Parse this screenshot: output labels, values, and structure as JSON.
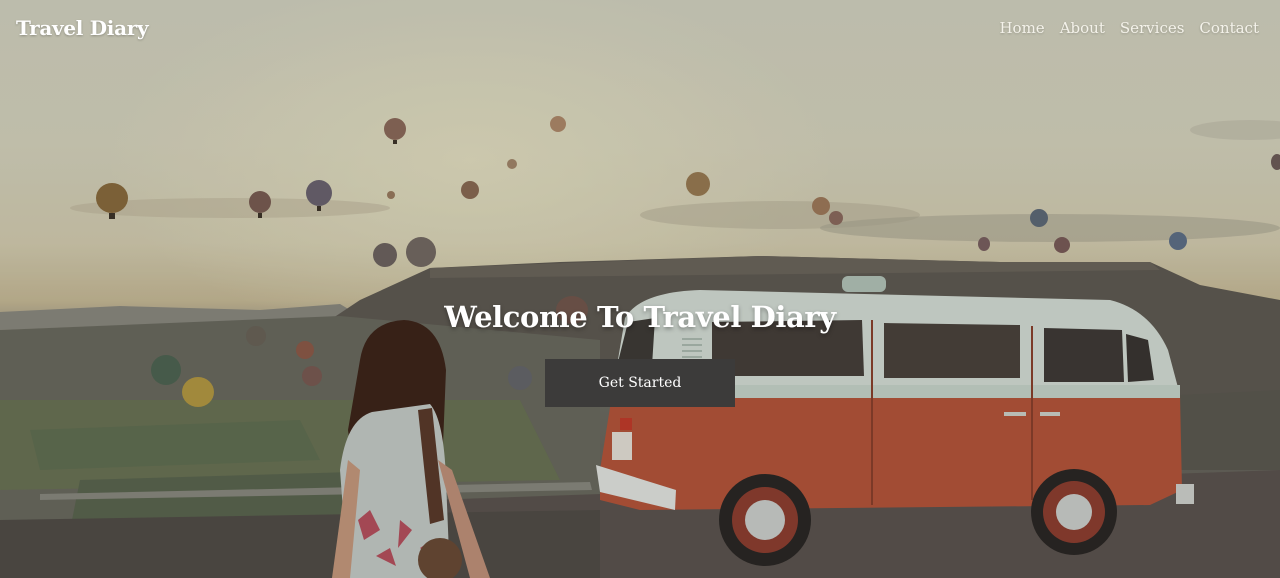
{
  "navbar": {
    "brand": "Travel Diary",
    "links": [
      "Home",
      "About",
      "Services",
      "Contact"
    ]
  },
  "hero": {
    "title": "Welcome To Travel Diary",
    "cta_label": "Get Started"
  },
  "colors": {
    "brand_text": "#ffffff",
    "button_bg": "#3c3b3a",
    "van_body": "#b7553a",
    "van_top": "#d9e3dc"
  }
}
